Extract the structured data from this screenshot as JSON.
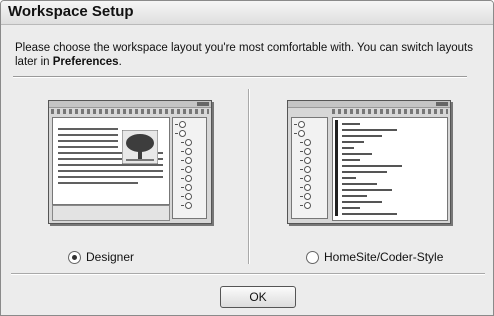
{
  "dialog": {
    "title": "Workspace Setup",
    "instructions_before_bold": "Please choose the workspace layout you're most comfortable with. You can switch layouts later in ",
    "instructions_bold": "Preferences",
    "instructions_after_bold": "."
  },
  "options": [
    {
      "label": "Designer",
      "selected": true,
      "preview_icon": "designer-layout-preview"
    },
    {
      "label": "HomeSite/Coder-Style",
      "selected": false,
      "preview_icon": "coder-layout-preview"
    }
  ],
  "footer": {
    "ok_label": "OK"
  }
}
